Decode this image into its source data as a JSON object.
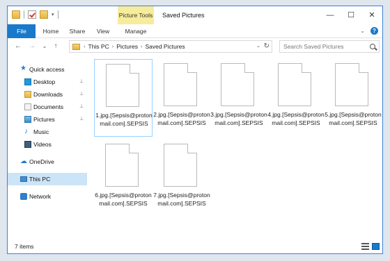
{
  "window": {
    "title": "Saved Pictures",
    "contextual_tab": "Picture Tools",
    "controls": {
      "minimize": "—",
      "maximize": "☐",
      "close": "✕"
    }
  },
  "quick_access_toolbar": {
    "dropdown": "▾"
  },
  "ribbon": {
    "tabs": [
      "File",
      "Home",
      "Share",
      "View",
      "Manage"
    ],
    "expand": "⌄",
    "help": "?"
  },
  "navigation": {
    "back": "←",
    "forward": "→",
    "recent": "⌄",
    "up": "↑",
    "breadcrumb": [
      "This PC",
      "Pictures",
      "Saved Pictures"
    ],
    "separator": "›",
    "dropdown": "⌄",
    "refresh": "↻",
    "search_placeholder": "Search Saved Pictures"
  },
  "sidebar": {
    "items": [
      {
        "label": "Quick access",
        "icon": "star-icon",
        "pinned": false
      },
      {
        "label": "Desktop",
        "icon": "desktop-icon",
        "pinned": true
      },
      {
        "label": "Downloads",
        "icon": "downloads-icon",
        "pinned": true
      },
      {
        "label": "Documents",
        "icon": "documents-icon",
        "pinned": true
      },
      {
        "label": "Pictures",
        "icon": "pictures-icon",
        "pinned": true
      },
      {
        "label": "Music",
        "icon": "music-icon",
        "pinned": false
      },
      {
        "label": "Videos",
        "icon": "videos-icon",
        "pinned": false
      },
      {
        "label": "OneDrive",
        "icon": "onedrive-icon",
        "pinned": false
      },
      {
        "label": "This PC",
        "icon": "this-pc-icon",
        "pinned": false,
        "selected": true
      },
      {
        "label": "Network",
        "icon": "network-icon",
        "pinned": false
      }
    ],
    "pin_glyph": "📌"
  },
  "files": [
    {
      "name": "1.jpg.[Sepsis@protonmail.com].SEPSIS",
      "selected": true
    },
    {
      "name": "2.jpg.[Sepsis@protonmail.com].SEPSIS"
    },
    {
      "name": "3.jpg.[Sepsis@protonmail.com].SEPSIS"
    },
    {
      "name": "4.jpg.[Sepsis@protonmail.com].SEPSIS"
    },
    {
      "name": "5.jpg.[Sepsis@protonmail.com].SEPSIS"
    },
    {
      "name": "6.jpg.[Sepsis@protonmail.com].SEPSIS"
    },
    {
      "name": "7.jpg.[Sepsis@protonmail.com].SEPSIS"
    }
  ],
  "status": {
    "item_count": "7 items"
  },
  "colors": {
    "accent": "#1979ca",
    "contextual_tab": "#f6ec9b",
    "selection": "#cce4f7"
  }
}
